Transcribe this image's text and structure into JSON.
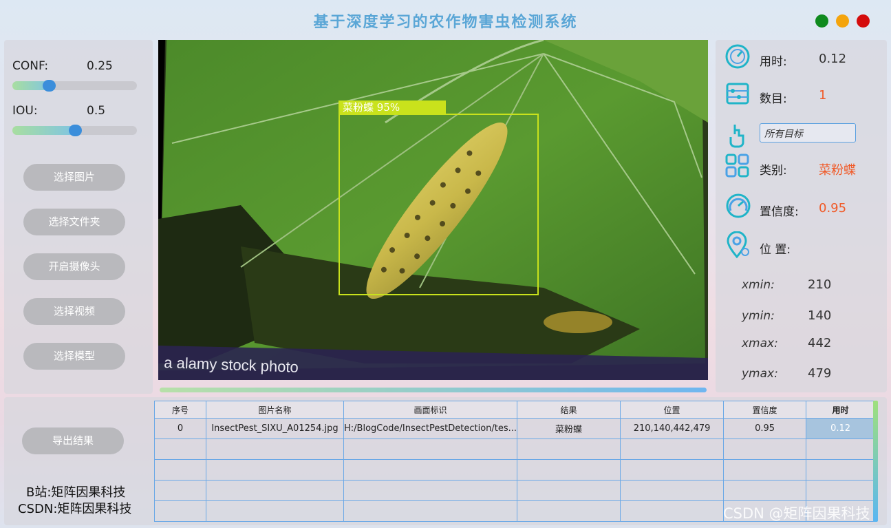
{
  "app": {
    "title": "基于深度学习的农作物害虫检测系统"
  },
  "params": {
    "conf_label": "CONF:",
    "conf_value": "0.25",
    "iou_label": "IOU:",
    "iou_value": "0.5"
  },
  "buttons": {
    "select_image": "选择图片",
    "select_folder": "选择文件夹",
    "open_camera": "开启摄像头",
    "select_video": "选择视频",
    "select_model": "选择模型",
    "export": "导出结果"
  },
  "detection": {
    "box_label": "菜粉蝶  95%",
    "photo_watermark": "a  alamy stock photo"
  },
  "result": {
    "time_label": "用时:",
    "time_value": "0.12",
    "count_label": "数目:",
    "count_value": "1",
    "target_select": "所有目标",
    "class_label": "类别:",
    "class_value": "菜粉蝶",
    "conf_label": "置信度:",
    "conf_value": "0.95",
    "pos_label": "位 置:",
    "xmin_label": "xmin:",
    "xmin": "210",
    "ymin_label": "ymin:",
    "ymin": "140",
    "xmax_label": "xmax:",
    "xmax": "442",
    "ymax_label": "ymax:",
    "ymax": "479"
  },
  "table": {
    "headers": [
      "序号",
      "图片名称",
      "画面标识",
      "结果",
      "位置",
      "置信度",
      "用时"
    ],
    "rows": [
      [
        "0",
        "InsectPest_SIXU_A01254.jpg",
        "H:/BlogCode/InsectPestDetection/tes...",
        "菜粉蝶",
        "210,140,442,479",
        "0.95",
        "0.12"
      ]
    ]
  },
  "credits": {
    "bilibili": "B站:矩阵因果科技",
    "csdn": "CSDN:矩阵因果科技",
    "watermark": "CSDN @矩阵因果科技"
  },
  "colors": {
    "accent_value": "#f05a28",
    "title": "#5aa6d6",
    "table_border": "#6aa8e6",
    "slider_knob": "#3b8edb"
  },
  "values": {
    "conf_slider": 0.25,
    "iou_slider": 0.5,
    "progress": 1.0
  }
}
